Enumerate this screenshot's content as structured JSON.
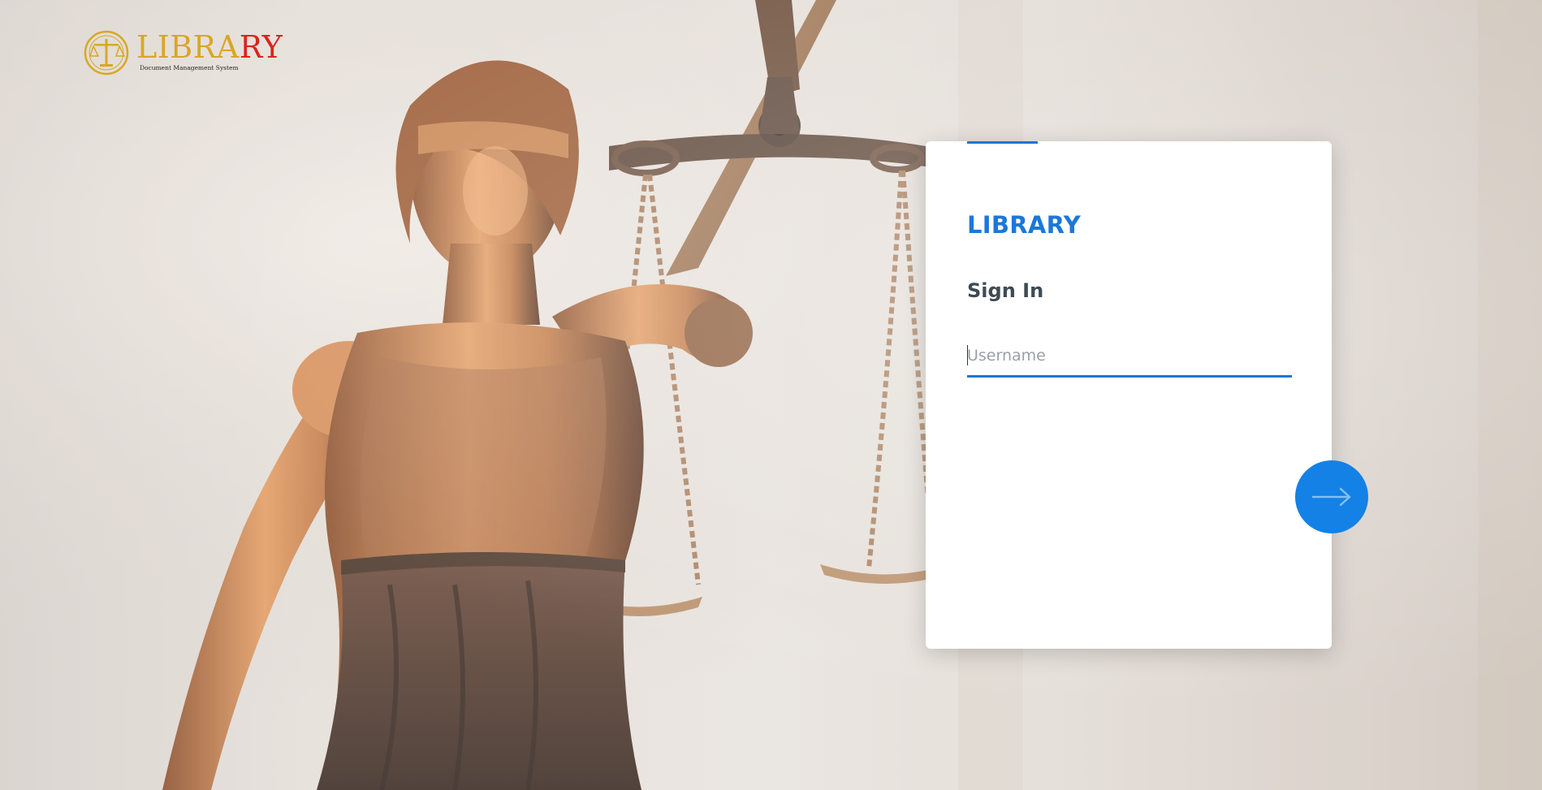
{
  "logo": {
    "word_part_a": "LIBRA",
    "word_part_b": "RY",
    "tagline": "Document Management System",
    "emblem_icon": "scales-of-justice-icon"
  },
  "login": {
    "brand": "LIBRARY",
    "heading": "Sign In",
    "username": {
      "placeholder": "Username",
      "value": ""
    },
    "submit_icon": "arrow-right-icon"
  },
  "colors": {
    "accent": "#1877d6",
    "brand_text": "#1b78d8",
    "button": "#1381e6",
    "heading_text": "#3f4a55",
    "logo_gold": "#d8a726",
    "logo_red": "#d8251e"
  }
}
